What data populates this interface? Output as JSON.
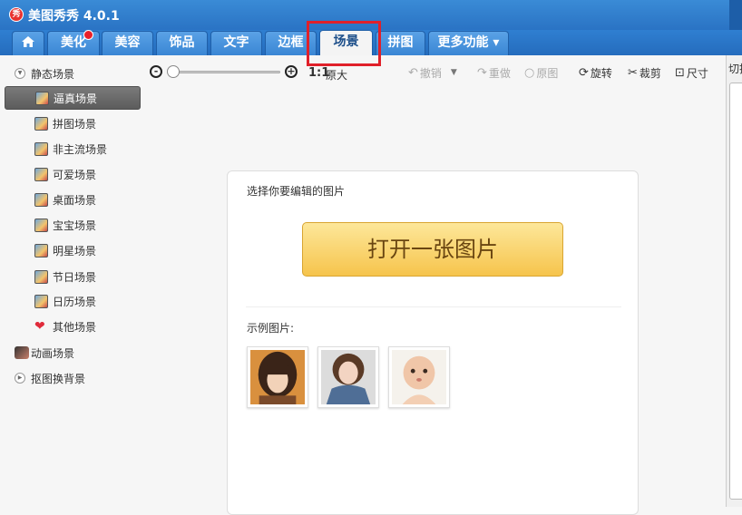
{
  "window": {
    "title": "美图秀秀 4.0.1",
    "logo_char": "秀"
  },
  "tabs": [
    {
      "label": "美化",
      "active": false,
      "badge": true
    },
    {
      "label": "美容",
      "active": false
    },
    {
      "label": "饰品",
      "active": false
    },
    {
      "label": "文字",
      "active": false
    },
    {
      "label": "边框",
      "active": false
    },
    {
      "label": "场景",
      "active": true
    },
    {
      "label": "拼图",
      "active": false
    },
    {
      "label": "更多功能 ▾",
      "active": false
    }
  ],
  "sidebar": {
    "static_category": {
      "label": "静态场景",
      "arrow": "▼"
    },
    "items": [
      {
        "label": "逼真场景",
        "selected": true
      },
      {
        "label": "拼图场景"
      },
      {
        "label": "非主流场景"
      },
      {
        "label": "可爱场景"
      },
      {
        "label": "桌面场景"
      },
      {
        "label": "宝宝场景"
      },
      {
        "label": "明星场景"
      },
      {
        "label": "节日场景"
      },
      {
        "label": "日历场景"
      },
      {
        "label": "其他场景",
        "icon": "heart-icon"
      }
    ],
    "animated_category": {
      "label": "动画场景"
    },
    "bg_category": {
      "label": "抠图换背景",
      "arrow": "▶"
    }
  },
  "toolbar": {
    "one_to_one": "1:1",
    "actual_size": "原大",
    "undo": "撤销",
    "redo": "重做",
    "original": "原图",
    "rotate": "旋转",
    "crop": "裁剪",
    "size": "尺寸",
    "zoom_level": 0
  },
  "card": {
    "prompt": "选择你要编辑的图片",
    "open_button": "打开一张图片",
    "sample_label": "示例图片:"
  },
  "right_panel": {
    "label": "切换"
  },
  "colors": {
    "titlebar": "#2a73c4",
    "highlight": "#e0202a",
    "open_button": "#f6c44c"
  }
}
